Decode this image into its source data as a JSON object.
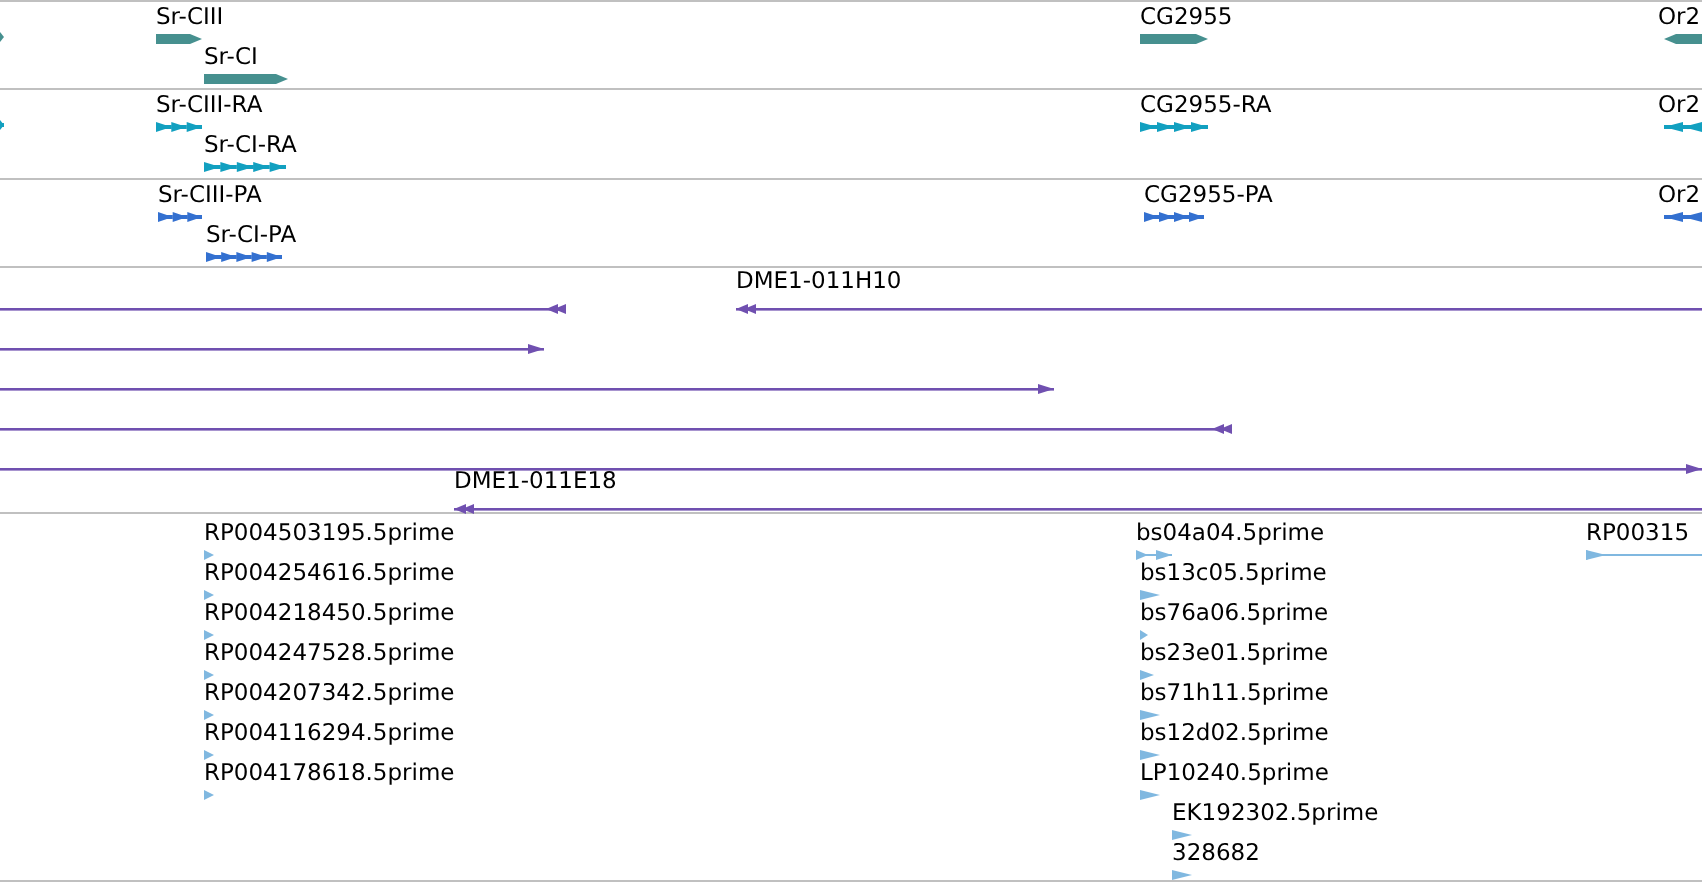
{
  "tracks": [
    {
      "kind": "gene",
      "color": "#46908f",
      "features": [
        {
          "reverse": false
        },
        {
          "label": "Sr-CIII",
          "reverse": false
        },
        {
          "label": "Sr-CI",
          "reverse": false
        },
        {
          "label": "CG2955",
          "reverse": false
        },
        {
          "label": "Or2",
          "reverse": true
        }
      ]
    },
    {
      "kind": "transcript",
      "color": "#12a0c0",
      "features": [
        {
          "reverse": false
        },
        {
          "label": "Sr-CIII-RA",
          "reverse": false
        },
        {
          "label": "Sr-CI-RA",
          "reverse": false
        },
        {
          "label": "CG2955-RA",
          "reverse": false
        },
        {
          "label": "Or2",
          "reverse": true
        }
      ]
    },
    {
      "kind": "transcript",
      "color": "#3370d0",
      "features": [
        {
          "label": "Sr-CIII-PA",
          "reverse": false
        },
        {
          "label": "Sr-CI-PA",
          "reverse": false
        },
        {
          "label": "CG2955-PA",
          "reverse": false
        },
        {
          "label": "Or2",
          "reverse": true
        }
      ]
    },
    {
      "kind": "clone",
      "color": "#7050b0",
      "features": [
        {
          "reverse": true
        },
        {
          "label": "DME1-011H10",
          "reverse": true
        },
        {
          "reverse": false
        },
        {
          "reverse": false
        },
        {
          "reverse": true
        },
        {
          "reverse": false
        },
        {
          "label": "DME1-011E18",
          "reverse": true
        }
      ]
    },
    {
      "kind": "est",
      "color": "#80b8e0",
      "features": [
        {
          "label": "RP004503195.5prime",
          "reverse": false
        },
        {
          "label": "RP004254616.5prime",
          "reverse": false
        },
        {
          "label": "RP004218450.5prime",
          "reverse": false
        },
        {
          "label": "RP004247528.5prime",
          "reverse": false
        },
        {
          "label": "RP004207342.5prime",
          "reverse": false
        },
        {
          "label": "RP004116294.5prime",
          "reverse": false
        },
        {
          "label": "RP004178618.5prime",
          "reverse": false
        },
        {
          "label": "bs04a04.5prime",
          "reverse": false
        },
        {
          "label": "bs13c05.5prime",
          "reverse": false
        },
        {
          "label": "bs76a06.5prime",
          "reverse": false
        },
        {
          "label": "bs23e01.5prime",
          "reverse": false
        },
        {
          "label": "bs71h11.5prime",
          "reverse": false
        },
        {
          "label": "bs12d02.5prime",
          "reverse": false
        },
        {
          "label": "LP10240.5prime",
          "reverse": false
        },
        {
          "label": "EK192302.5prime",
          "reverse": false
        },
        {
          "label": "328682",
          "reverse": false
        },
        {
          "label": "RP00315",
          "reverse": false
        }
      ]
    }
  ]
}
